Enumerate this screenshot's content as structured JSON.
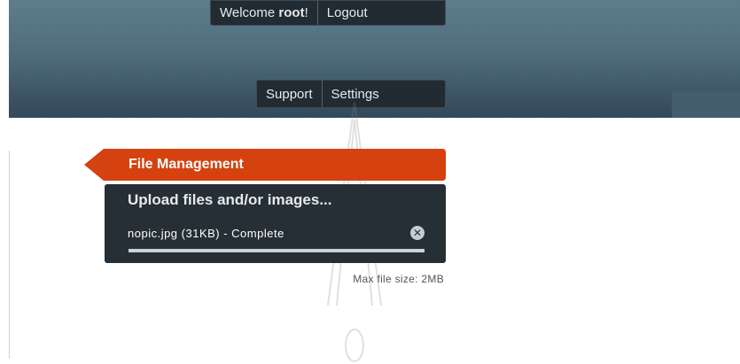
{
  "header": {
    "welcome_prefix": "Welcome ",
    "username": "root",
    "welcome_suffix": "!",
    "logout_label": "Logout",
    "nav": {
      "support_label": "Support",
      "settings_label": "Settings"
    }
  },
  "file_management": {
    "title": "File Management",
    "upload_title": "Upload files and/or images...",
    "file": {
      "text": "nopic.jpg (31KB) - Complete",
      "progress": 1.0
    },
    "remove_icon": "close-icon",
    "max_size_text": "Max file size: 2MB"
  },
  "colors": {
    "accent": "#d5420f",
    "panel": "#252f35",
    "header": "#4f6d7d"
  }
}
